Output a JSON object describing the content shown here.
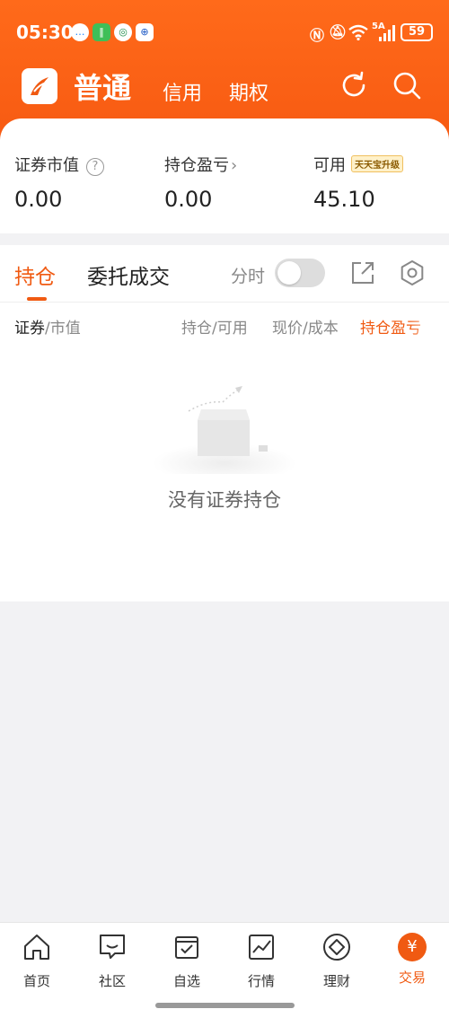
{
  "status_bar": {
    "time": "05:30",
    "app_icons": [
      "message-icon",
      "app-icon",
      "bank-icon",
      "bank-icon"
    ],
    "signal": "5A",
    "battery": "59"
  },
  "header": {
    "active_tab": "普通",
    "tabs": [
      "信用",
      "期权"
    ],
    "icons": [
      "refresh-icon",
      "search-icon"
    ]
  },
  "summary": {
    "market_value": {
      "label": "证券市值",
      "value": "0.00"
    },
    "position_pl": {
      "label": "持仓盈亏",
      "value": "0.00"
    },
    "available": {
      "label": "可用",
      "value": "45.10",
      "badge": "天天宝升级"
    }
  },
  "holdings": {
    "tabs": [
      "持仓",
      "委托成交"
    ],
    "timeshare_label": "分时",
    "timeshare_on": false,
    "columns": {
      "security_a": "证券",
      "security_b": "/市值",
      "position": "持仓/可用",
      "price": "现价/成本",
      "pl": "持仓盈亏"
    },
    "empty_text": "没有证券持仓"
  },
  "bottom_nav": [
    {
      "label": "首页",
      "icon": "home-icon"
    },
    {
      "label": "社区",
      "icon": "chat-icon"
    },
    {
      "label": "自选",
      "icon": "bookmark-icon"
    },
    {
      "label": "行情",
      "icon": "chart-icon"
    },
    {
      "label": "理财",
      "icon": "diamond-icon"
    },
    {
      "label": "交易",
      "icon": "yuan-icon"
    }
  ],
  "colors": {
    "accent": "#f05a12",
    "header_bg": "#ff6a1a"
  }
}
